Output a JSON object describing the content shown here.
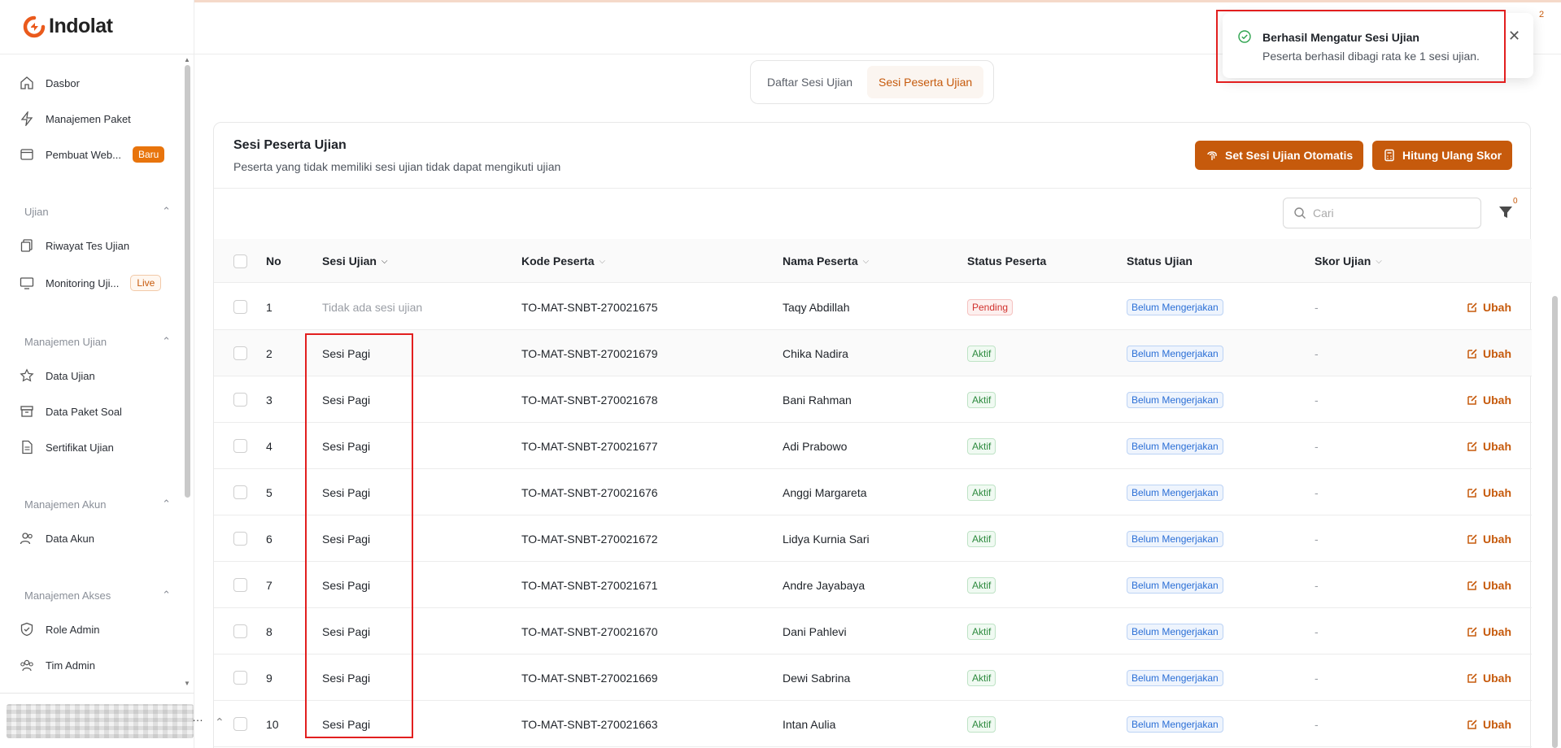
{
  "app": {
    "name": "Indolat",
    "notification_count": "2"
  },
  "sidebar": {
    "items": [
      {
        "label": "Dasbor",
        "icon": "home-icon"
      },
      {
        "label": "Manajemen Paket",
        "icon": "bolt-icon"
      },
      {
        "label": "Pembuat Web...",
        "icon": "browser-icon",
        "badge": "Baru"
      }
    ],
    "groups": [
      {
        "title": "Ujian",
        "items": [
          {
            "label": "Riwayat Tes Ujian",
            "icon": "copy-icon"
          },
          {
            "label": "Monitoring Uji...",
            "icon": "monitor-icon",
            "badge": "Live"
          }
        ]
      },
      {
        "title": "Manajemen Ujian",
        "items": [
          {
            "label": "Data Ujian",
            "icon": "star-icon"
          },
          {
            "label": "Data Paket Soal",
            "icon": "archive-icon"
          },
          {
            "label": "Sertifikat Ujian",
            "icon": "file-icon"
          }
        ]
      },
      {
        "title": "Manajemen Akun",
        "items": [
          {
            "label": "Data Akun",
            "icon": "users-icon"
          }
        ]
      },
      {
        "title": "Manajemen Akses",
        "items": [
          {
            "label": "Role Admin",
            "icon": "shield-icon"
          },
          {
            "label": "Tim Admin",
            "icon": "team-icon"
          }
        ]
      }
    ]
  },
  "tabs": [
    {
      "label": "Daftar Sesi Ujian",
      "active": false
    },
    {
      "label": "Sesi Peserta Ujian",
      "active": true
    }
  ],
  "card": {
    "title": "Sesi Peserta Ujian",
    "subtitle": "Peserta yang tidak memiliki sesi ujian tidak dapat mengikuti ujian",
    "btn_auto": "Set Sesi Ujian Otomatis",
    "btn_recount": "Hitung Ulang Skor",
    "search_placeholder": "Cari",
    "filter_count": "0"
  },
  "table": {
    "headers": {
      "no": "No",
      "session": "Sesi Ujian",
      "code": "Kode Peserta",
      "name": "Nama Peserta",
      "participant_status": "Status Peserta",
      "exam_status": "Status Ujian",
      "score": "Skor Ujian"
    },
    "edit_label": "Ubah",
    "rows": [
      {
        "no": "1",
        "session": "Tidak ada sesi ujian",
        "code": "TO-MAT-SNBT-270021675",
        "name": "Taqy Abdillah",
        "participant_status": "Pending",
        "exam_status": "Belum Mengerjakan",
        "score": "-"
      },
      {
        "no": "2",
        "session": "Sesi Pagi",
        "code": "TO-MAT-SNBT-270021679",
        "name": "Chika Nadira",
        "participant_status": "Aktif",
        "exam_status": "Belum Mengerjakan",
        "score": "-"
      },
      {
        "no": "3",
        "session": "Sesi Pagi",
        "code": "TO-MAT-SNBT-270021678",
        "name": "Bani Rahman",
        "participant_status": "Aktif",
        "exam_status": "Belum Mengerjakan",
        "score": "-"
      },
      {
        "no": "4",
        "session": "Sesi Pagi",
        "code": "TO-MAT-SNBT-270021677",
        "name": "Adi Prabowo",
        "participant_status": "Aktif",
        "exam_status": "Belum Mengerjakan",
        "score": "-"
      },
      {
        "no": "5",
        "session": "Sesi Pagi",
        "code": "TO-MAT-SNBT-270021676",
        "name": "Anggi Margareta",
        "participant_status": "Aktif",
        "exam_status": "Belum Mengerjakan",
        "score": "-"
      },
      {
        "no": "6",
        "session": "Sesi Pagi",
        "code": "TO-MAT-SNBT-270021672",
        "name": "Lidya Kurnia Sari",
        "participant_status": "Aktif",
        "exam_status": "Belum Mengerjakan",
        "score": "-"
      },
      {
        "no": "7",
        "session": "Sesi Pagi",
        "code": "TO-MAT-SNBT-270021671",
        "name": "Andre Jayabaya",
        "participant_status": "Aktif",
        "exam_status": "Belum Mengerjakan",
        "score": "-"
      },
      {
        "no": "8",
        "session": "Sesi Pagi",
        "code": "TO-MAT-SNBT-270021670",
        "name": "Dani Pahlevi",
        "participant_status": "Aktif",
        "exam_status": "Belum Mengerjakan",
        "score": "-"
      },
      {
        "no": "9",
        "session": "Sesi Pagi",
        "code": "TO-MAT-SNBT-270021669",
        "name": "Dewi Sabrina",
        "participant_status": "Aktif",
        "exam_status": "Belum Mengerjakan",
        "score": "-"
      },
      {
        "no": "10",
        "session": "Sesi Pagi",
        "code": "TO-MAT-SNBT-270021663",
        "name": "Intan Aulia",
        "participant_status": "Aktif",
        "exam_status": "Belum Mengerjakan",
        "score": "-"
      }
    ]
  },
  "toast": {
    "title": "Berhasil Mengatur Sesi Ujian",
    "message": "Peserta berhasil dibagi rata ke 1 sesi ujian."
  },
  "colors": {
    "accent": "#c65a0c",
    "highlight": "#e21f1f"
  }
}
